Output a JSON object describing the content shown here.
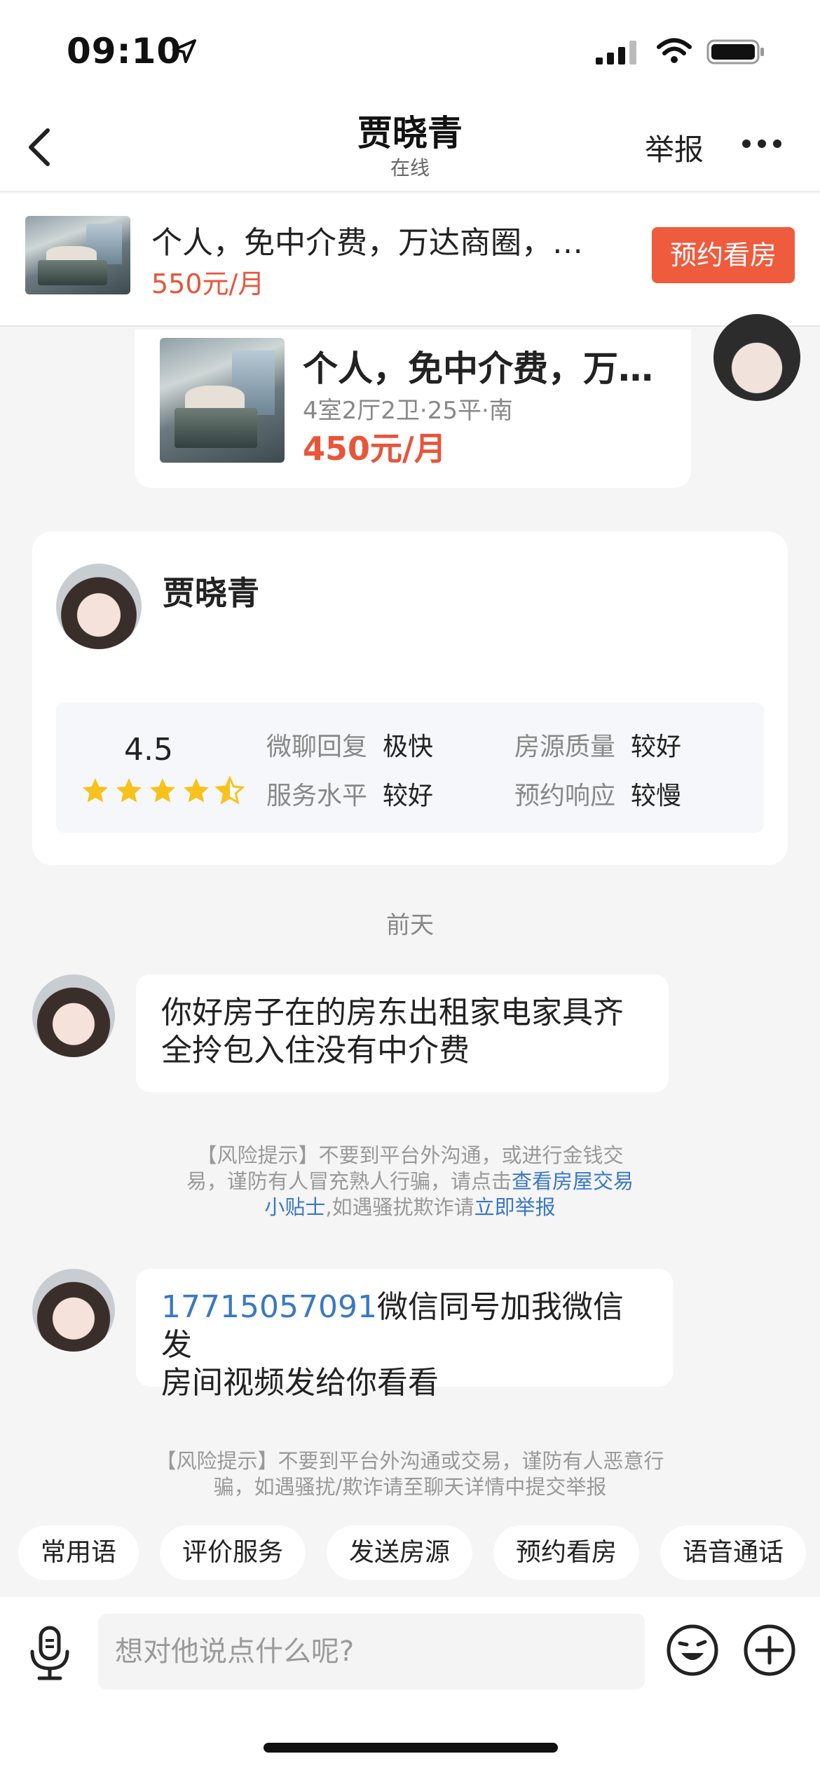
{
  "status": {
    "time": "09:10"
  },
  "nav": {
    "title": "贾晓青",
    "subtitle": "在线",
    "report": "举报"
  },
  "listing": {
    "title": "个人，免中介费，万达商圈，…",
    "price": "550元/月",
    "book_button": "预约看房"
  },
  "house_card": {
    "title": "个人，免中介费，万…",
    "meta": "4室2厅2卫·25平·南",
    "price": "450元/月"
  },
  "profile": {
    "name": "贾晓青",
    "rating": "4.5",
    "stars": 4.5,
    "metrics": [
      {
        "label": "微聊回复",
        "value": "极快"
      },
      {
        "label": "房源质量",
        "value": "较好"
      },
      {
        "label": "服务水平",
        "value": "较好"
      },
      {
        "label": "预约响应",
        "value": "较慢"
      }
    ]
  },
  "chat": {
    "date_separator": "前天",
    "message1": {
      "line1": "你好房子在的房东出租家电家具齐",
      "line2": "全拎包入住没有中介费"
    },
    "risk1": {
      "text1": "【风险提示】不要到平台外沟通，或进行金钱交",
      "text2": "易，谨防有人冒充熟人行骗，请点击",
      "link1": "查看房屋交易",
      "link1b": "小贴士",
      "text3": ",如遇骚扰欺诈请",
      "link2": "立即举报"
    },
    "message2": {
      "phone": "17715057091",
      "line1_rest": "微信同号加我微信发",
      "line2": "房间视频发给你看看"
    },
    "risk2": {
      "line1": "【风险提示】不要到平台外沟通或交易，谨防有人恶意行",
      "line2": "骗，如遇骚扰/欺诈请至聊天详情中提交举报"
    }
  },
  "chips": [
    "常用语",
    "评价服务",
    "发送房源",
    "预约看房",
    "语音通话"
  ],
  "input": {
    "placeholder": "想对他说点什么呢?"
  },
  "colors": {
    "accent": "#ef5b3d",
    "price": "#e8553a",
    "link": "#3a78c2",
    "star": "#f7c21c"
  }
}
